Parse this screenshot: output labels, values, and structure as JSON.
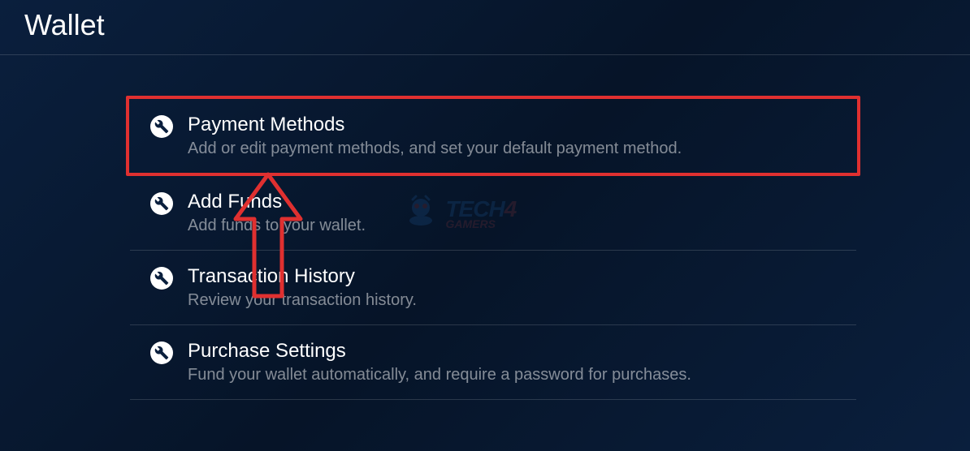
{
  "header": {
    "title": "Wallet"
  },
  "menu": {
    "items": [
      {
        "title": "Payment Methods",
        "description": "Add or edit payment methods, and set your default payment method.",
        "highlighted": true
      },
      {
        "title": "Add Funds",
        "description": "Add funds to your wallet.",
        "highlighted": false
      },
      {
        "title": "Transaction History",
        "description": "Review your transaction history.",
        "highlighted": false
      },
      {
        "title": "Purchase Settings",
        "description": "Fund your wallet automatically, and require a password for purchases.",
        "highlighted": false
      }
    ]
  },
  "annotation": {
    "arrow_color": "#e03030",
    "highlight_color": "#e03030"
  },
  "watermark": {
    "text_primary": "TECH",
    "text_accent": "4",
    "text_secondary": "GAMERS"
  }
}
